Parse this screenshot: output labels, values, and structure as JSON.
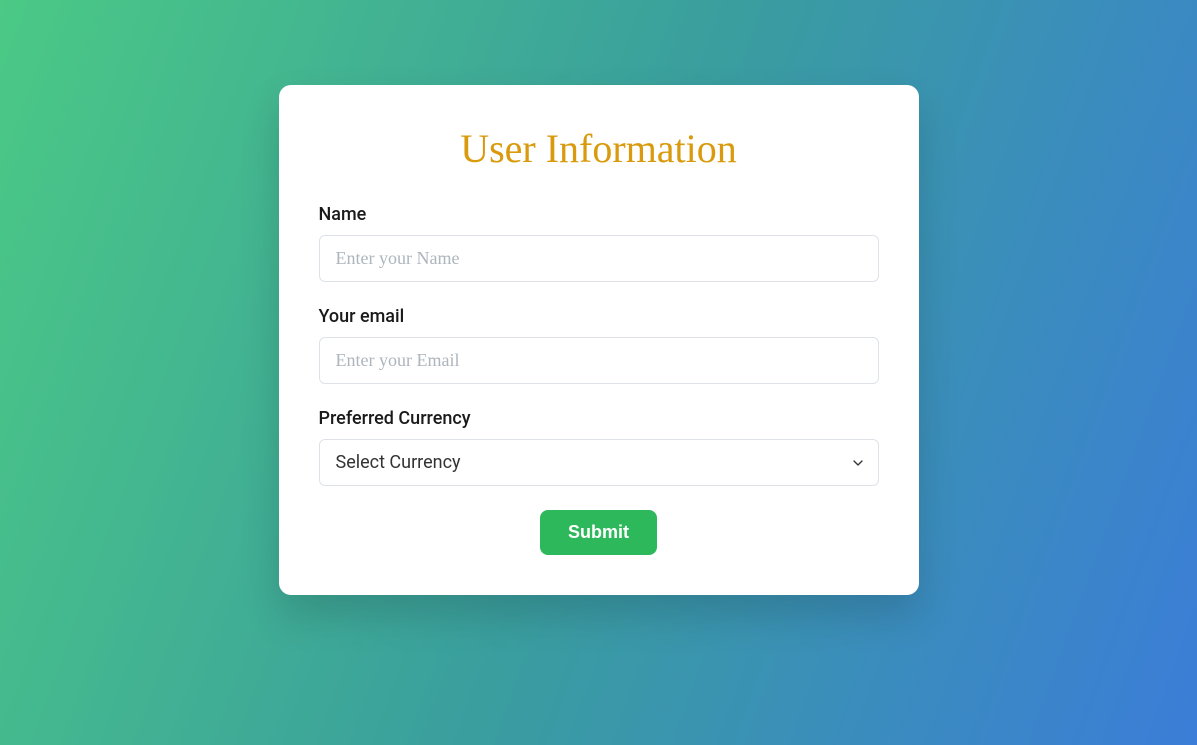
{
  "form": {
    "title": "User Information",
    "fields": {
      "name": {
        "label": "Name",
        "placeholder": "Enter your Name",
        "value": ""
      },
      "email": {
        "label": "Your email",
        "placeholder": "Enter your Email",
        "value": ""
      },
      "currency": {
        "label": "Preferred Currency",
        "selected": "Select Currency"
      }
    },
    "submit_label": "Submit"
  }
}
